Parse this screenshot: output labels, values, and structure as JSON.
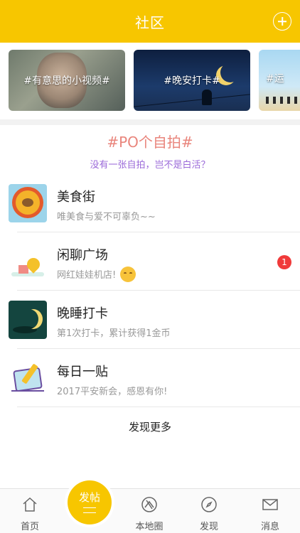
{
  "header": {
    "title": "社区",
    "plus_icon": "plus-circle-icon"
  },
  "carousel": [
    {
      "label": "#有意思的小视频#"
    },
    {
      "label": "#晚安打卡#"
    },
    {
      "label": "#运"
    }
  ],
  "topic": {
    "title": "#PO个自拍#",
    "subtitle": "没有一张自拍，岂不是白活？"
  },
  "list": [
    {
      "title": "美食街",
      "desc": "唯美食与爱不可辜负~~"
    },
    {
      "title": "闲聊广场",
      "desc": "网红娃娃机店!",
      "badge": "1"
    },
    {
      "title": "晚睡打卡",
      "desc": "第1次打卡，累计获得1金币"
    },
    {
      "title": "每日一贴",
      "desc": "2017平安新会，感恩有你!"
    }
  ],
  "more_label": "发现更多",
  "tabbar": {
    "home": "首页",
    "post": "发帖",
    "map": "本地圈",
    "discover": "发现",
    "messages": "消息"
  },
  "colors": {
    "accent": "#f7c600",
    "topic": "#e9857c",
    "subtitle": "#9b6ad9",
    "badge": "#f03a3a"
  }
}
